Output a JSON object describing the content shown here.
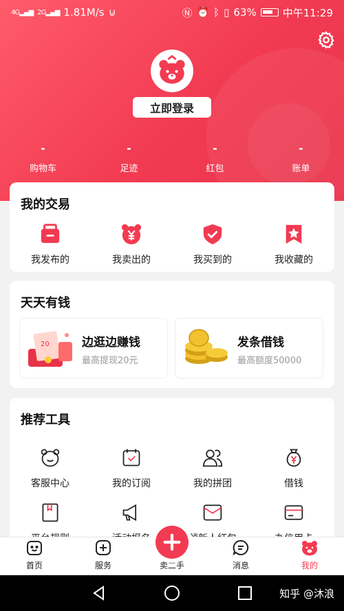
{
  "status_bar": {
    "signal_1": "4G",
    "signal_2": "2G",
    "speed": "1.81M/s",
    "battery": "63%",
    "time": "中午11:29"
  },
  "profile": {
    "login_label": "立即登录"
  },
  "stats": [
    {
      "value": "-",
      "label": "购物车"
    },
    {
      "value": "-",
      "label": "足迹"
    },
    {
      "value": "-",
      "label": "红包"
    },
    {
      "value": "-",
      "label": "账单"
    }
  ],
  "trade": {
    "title": "我的交易",
    "items": [
      {
        "label": "我发布的",
        "icon": "bag-icon"
      },
      {
        "label": "我卖出的",
        "icon": "yen-bear-icon"
      },
      {
        "label": "我买到的",
        "icon": "shield-check-icon"
      },
      {
        "label": "我收藏的",
        "icon": "bookmark-star-icon"
      }
    ]
  },
  "money": {
    "title": "天天有钱",
    "boxes": [
      {
        "title": "边逛边赚钱",
        "subtitle": "最高提现20元",
        "badge": "20"
      },
      {
        "title": "发条借钱",
        "subtitle": "最高额度50000"
      }
    ]
  },
  "tools": {
    "title": "推荐工具",
    "items": [
      {
        "label": "客服中心",
        "icon": "bear-face-icon"
      },
      {
        "label": "我的订阅",
        "icon": "calendar-check-icon"
      },
      {
        "label": "我的拼团",
        "icon": "group-users-icon"
      },
      {
        "label": "借钱",
        "icon": "money-bag-icon"
      },
      {
        "label": "平台规则",
        "icon": "rule-book-icon"
      },
      {
        "label": "活动报名",
        "icon": "megaphone-icon"
      },
      {
        "label": "领新人红包",
        "icon": "envelope-icon"
      },
      {
        "label": "办信用卡",
        "icon": "credit-card-icon"
      }
    ]
  },
  "bottom_nav": {
    "items": [
      {
        "label": "首页",
        "icon": "home-face-icon"
      },
      {
        "label": "服务",
        "icon": "plus-square-icon"
      },
      {
        "label": "卖二手",
        "icon": "plus-circle-icon"
      },
      {
        "label": "消息",
        "icon": "chat-icon"
      },
      {
        "label": "我的",
        "icon": "bear-icon"
      }
    ]
  },
  "system": {
    "watermark": "知乎 @沐浪"
  },
  "colors": {
    "accent": "#f23b52",
    "header_start": "#ff5b6a",
    "header_end": "#e8334b"
  }
}
